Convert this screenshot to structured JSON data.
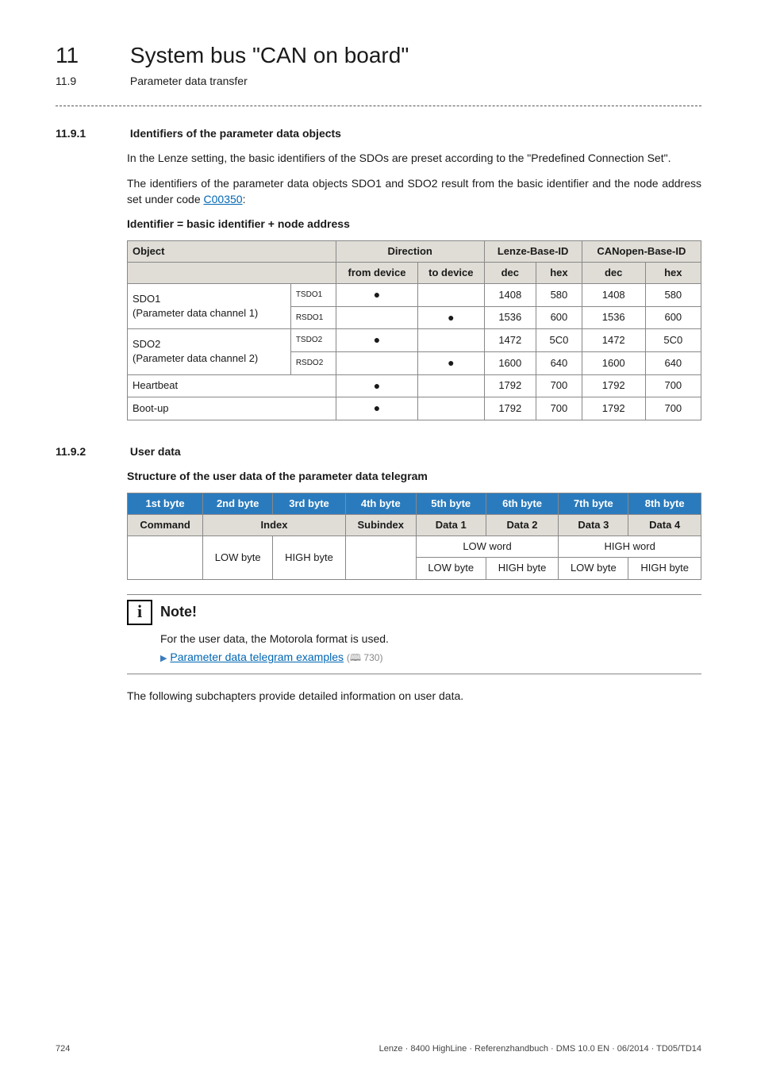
{
  "header": {
    "chapter_num": "11",
    "chapter_title": "System bus \"CAN on board\"",
    "sub_num": "11.9",
    "sub_title": "Parameter data transfer"
  },
  "s1": {
    "num": "11.9.1",
    "title": "Identifiers of the parameter data objects",
    "p1": "In the Lenze setting, the basic identifiers of the SDOs are preset according to the \"Predefined Connection Set\".",
    "p2a": "The identifiers of the parameter data objects SDO1 and SDO2 result from the basic identifier and the node address set under code ",
    "p2_link": "C00350",
    "p2b": ":",
    "formula": "Identifier = basic identifier + node address"
  },
  "t1": {
    "h_object": "Object",
    "h_direction": "Direction",
    "h_lenze": "Lenze-Base-ID",
    "h_canopen": "CANopen-Base-ID",
    "h_from": "from device",
    "h_to": "to device",
    "h_dec": "dec",
    "h_hex": "hex",
    "rows": [
      {
        "obj": "SDO1",
        "sub": "(Parameter data channel 1)",
        "tag": "TSDO1",
        "from": "●",
        "to": "",
        "ld": "1408",
        "lh": "580",
        "cd": "1408",
        "ch": "580"
      },
      {
        "obj": "",
        "sub": "",
        "tag": "RSDO1",
        "from": "",
        "to": "●",
        "ld": "1536",
        "lh": "600",
        "cd": "1536",
        "ch": "600"
      },
      {
        "obj": "SDO2",
        "sub": "(Parameter data channel 2)",
        "tag": "TSDO2",
        "from": "●",
        "to": "",
        "ld": "1472",
        "lh": "5C0",
        "cd": "1472",
        "ch": "5C0"
      },
      {
        "obj": "",
        "sub": "",
        "tag": "RSDO2",
        "from": "",
        "to": "●",
        "ld": "1600",
        "lh": "640",
        "cd": "1600",
        "ch": "640"
      },
      {
        "obj": "Heartbeat",
        "sub": "",
        "tag": "",
        "from": "●",
        "to": "",
        "ld": "1792",
        "lh": "700",
        "cd": "1792",
        "ch": "700"
      },
      {
        "obj": "Boot-up",
        "sub": "",
        "tag": "",
        "from": "●",
        "to": "",
        "ld": "1792",
        "lh": "700",
        "cd": "1792",
        "ch": "700"
      }
    ]
  },
  "s2": {
    "num": "11.9.2",
    "title": "User data",
    "sub": "Structure of the user data of the parameter data telegram"
  },
  "t2": {
    "h_bytes": [
      "1st byte",
      "2nd byte",
      "3rd byte",
      "4th byte",
      "5th byte",
      "6th byte",
      "7th byte",
      "8th byte"
    ],
    "r2": [
      "Command",
      "Index",
      "Subindex",
      "Data 1",
      "Data 2",
      "Data 3",
      "Data 4"
    ],
    "r3": {
      "low": "LOW byte",
      "high": "HIGH byte",
      "loww": "LOW word",
      "highw": "HIGH word"
    },
    "r4": {
      "low": "LOW byte",
      "high": "HIGH byte"
    }
  },
  "note": {
    "title": "Note!",
    "l1": "For the user data, the Motorola format is used.",
    "link": "Parameter data telegram examples",
    "pg": "730"
  },
  "after_note": "The following subchapters provide detailed information on user data.",
  "footer": {
    "page": "724",
    "text": "Lenze · 8400 HighLine · Referenzhandbuch · DMS 10.0 EN · 06/2014 · TD05/TD14"
  }
}
